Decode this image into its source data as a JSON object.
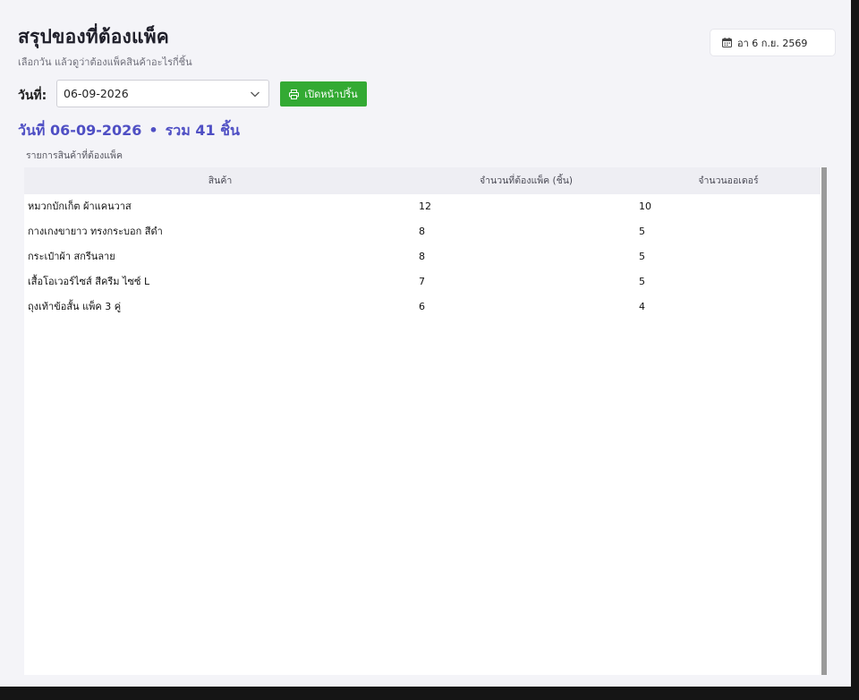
{
  "header": {
    "title": "สรุปของที่ต้องแพ็ค",
    "subtitle": "เลือกวัน แล้วดูว่าต้องแพ็คสินค้าอะไรกี่ชิ้น",
    "date_chip": "อา 6 ก.ย. 2569"
  },
  "filter": {
    "date_label": "วันที่:",
    "date_value": "06-09-2026",
    "print_label": "เปิดหน้าปริ้น"
  },
  "summary": {
    "date_text": "วันที่ 06-09-2026",
    "separator": "•",
    "total_text": "รวม 41 ชิ้น"
  },
  "table": {
    "caption": "รายการสินค้าที่ต้องแพ็ค",
    "columns": [
      "สินค้า",
      "จำนวนที่ต้องแพ็ค (ชิ้น)",
      "จำนวนออเดอร์"
    ],
    "rows": [
      {
        "product": "หมวกบักเก็ต ผ้าแคนวาส",
        "qty": "12",
        "orders": "10"
      },
      {
        "product": "กางเกงขายาว ทรงกระบอก สีดำ",
        "qty": "8",
        "orders": "5"
      },
      {
        "product": "กระเป๋าผ้า สกรีนลาย",
        "qty": "8",
        "orders": "5"
      },
      {
        "product": "เสื้อโอเวอร์ไซส์ สีครีม ไซซ์ L",
        "qty": "7",
        "orders": "5"
      },
      {
        "product": "ถุงเท้าข้อสั้น แพ็ค 3 คู่",
        "qty": "6",
        "orders": "4"
      }
    ]
  },
  "icons": {
    "date_chip": "calendar-icon",
    "date_select": "chevron-down-icon",
    "print_button": "printer-icon"
  },
  "colors": {
    "accent": "#4f4fc4",
    "print_button": "#33aa33",
    "background": "#f4f4f8"
  }
}
